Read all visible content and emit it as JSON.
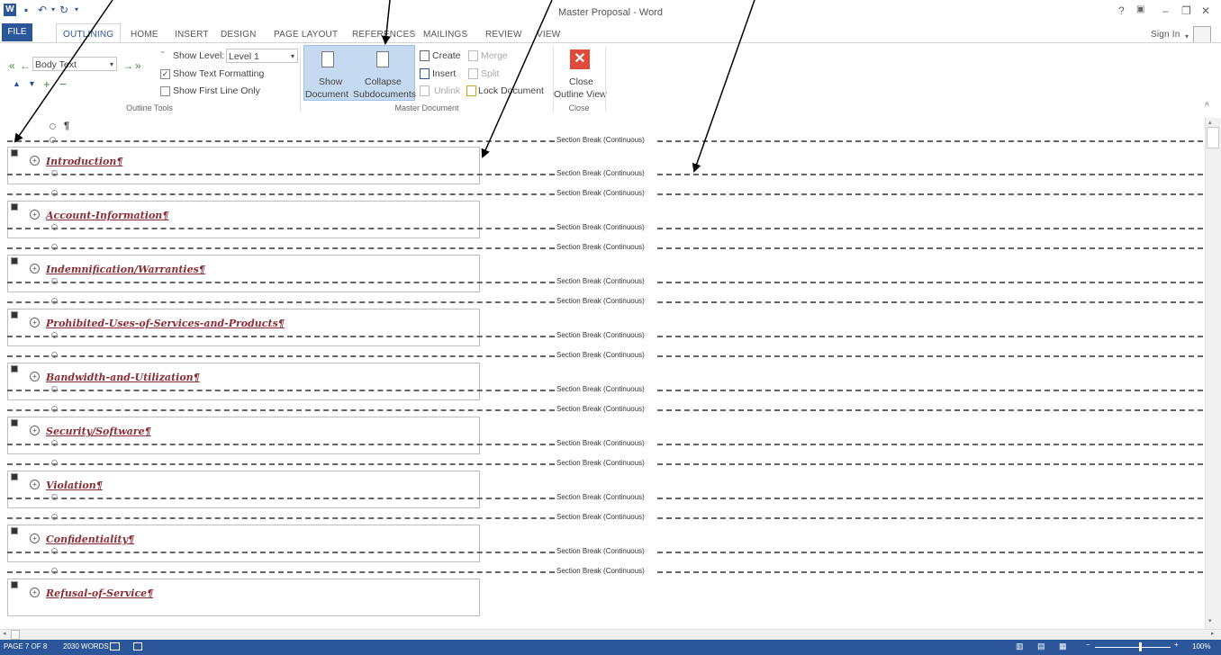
{
  "window": {
    "title": "Master Proposal - Word",
    "controls": [
      "?",
      "🗗",
      "—",
      "🗗",
      "✕"
    ],
    "sign_in": "Sign In"
  },
  "tabs": [
    "FILE",
    "OUTLINING",
    "HOME",
    "INSERT",
    "DESIGN",
    "PAGE LAYOUT",
    "REFERENCES",
    "MAILINGS",
    "REVIEW",
    "VIEW"
  ],
  "outline_tools": {
    "level_dropdown": "Body Text",
    "show_level_label": "Show Level:",
    "show_level_value": "Level 1",
    "show_text_formatting": "Show Text Formatting",
    "show_first_line_only": "Show First Line Only",
    "group_label": "Outline Tools"
  },
  "master_document": {
    "show_document_1": "Show",
    "show_document_2": "Document",
    "collapse_1": "Collapse",
    "collapse_2": "Subdocuments",
    "create": "Create",
    "insert": "Insert",
    "unlink": "Unlink",
    "merge": "Merge",
    "split": "Split",
    "lock_document": "Lock Document",
    "group_label": "Master Document"
  },
  "close_group": {
    "close_1": "Close",
    "close_2": "Outline View",
    "group_label": "Close"
  },
  "document": {
    "first_mark": "¶",
    "section_break": "Section Break (Continuous)",
    "subdocuments": [
      "Introduction¶",
      "Account-Information¶",
      "Indemnification/Warranties¶",
      "Prohibited-Uses-of-Services-and-Products¶",
      "Bandwidth-and-Utilization¶",
      "Security/Software¶",
      "Violation¶",
      "Confidentiality¶",
      "Refusal-of-Service¶"
    ]
  },
  "status": {
    "page": "PAGE 7 OF 8",
    "words": "2030 WORDS",
    "zoom": "100%"
  }
}
